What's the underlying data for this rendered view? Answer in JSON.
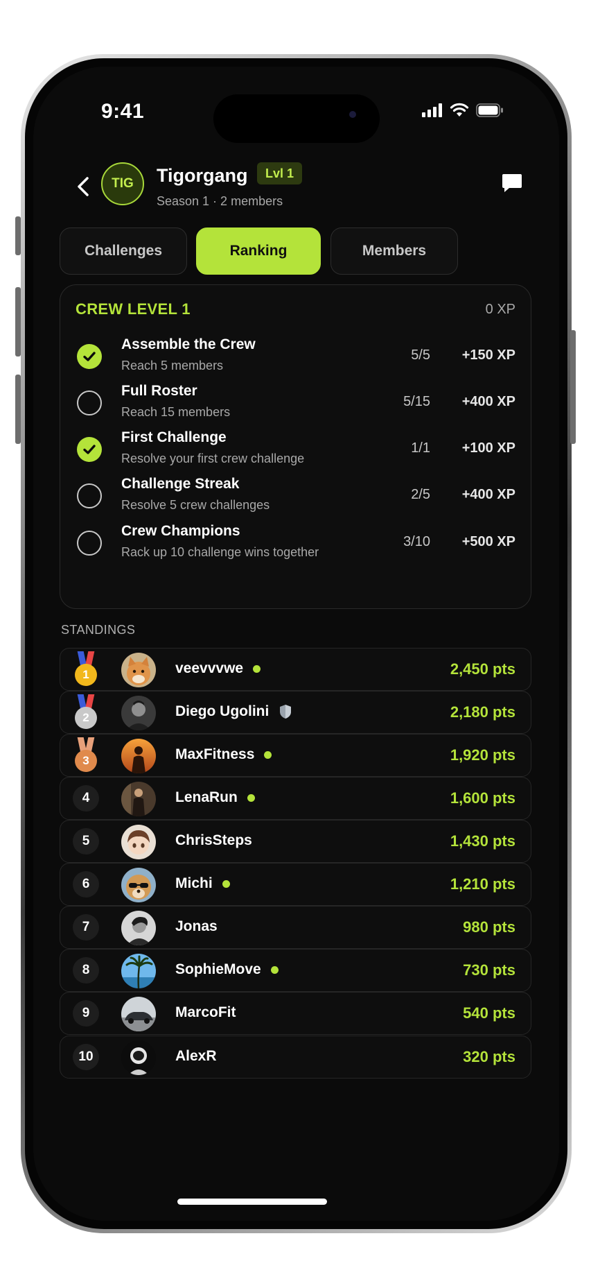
{
  "status_bar": {
    "time": "9:41"
  },
  "header": {
    "avatar_initials": "TIG",
    "crew_name": "Tigorgang",
    "level_badge": "Lvl 1",
    "subtitle": "Season 1 · 2 members"
  },
  "tabs": [
    {
      "label": "Challenges",
      "active": false
    },
    {
      "label": "Ranking",
      "active": true
    },
    {
      "label": "Members",
      "active": false
    }
  ],
  "crew_level": {
    "title": "CREW LEVEL 1",
    "xp": "0 XP",
    "goals": [
      {
        "title": "Assemble the Crew",
        "desc": "Reach 5 members",
        "progress": "5/5",
        "xp": "+150 XP",
        "done": true
      },
      {
        "title": "Full Roster",
        "desc": "Reach 15 members",
        "progress": "5/15",
        "xp": "+400 XP",
        "done": false
      },
      {
        "title": "First Challenge",
        "desc": "Resolve your first crew challenge",
        "progress": "1/1",
        "xp": "+100 XP",
        "done": true
      },
      {
        "title": "Challenge Streak",
        "desc": "Resolve 5 crew challenges",
        "progress": "2/5",
        "xp": "+400 XP",
        "done": false
      },
      {
        "title": "Crew Champions",
        "desc": "Rack up 10 challenge wins together",
        "progress": "3/10",
        "xp": "+500 XP",
        "done": false
      }
    ]
  },
  "standings": {
    "label": "STANDINGS",
    "rows": [
      {
        "rank": "1",
        "name": "veevvvwe",
        "points": "2,450 pts",
        "online": true,
        "medal": "gold",
        "avatar": "cat-avatar"
      },
      {
        "rank": "2",
        "name": "Diego Ugolini",
        "points": "2,180 pts",
        "online": false,
        "badge": "shield-icon",
        "medal": "silver",
        "avatar": "portrait-avatar"
      },
      {
        "rank": "3",
        "name": "MaxFitness",
        "points": "1,920 pts",
        "online": true,
        "medal": "bronze",
        "avatar": "sunset-silhouette-avatar"
      },
      {
        "rank": "4",
        "name": "LenaRun",
        "points": "1,600 pts",
        "online": true,
        "avatar": "figure-avatar"
      },
      {
        "rank": "5",
        "name": "ChrisSteps",
        "points": "1,430 pts",
        "online": false,
        "avatar": "anime-avatar"
      },
      {
        "rank": "6",
        "name": "Michi",
        "points": "1,210 pts",
        "online": true,
        "avatar": "dog-sunglasses-avatar"
      },
      {
        "rank": "7",
        "name": "Jonas",
        "points": "980 pts",
        "online": false,
        "avatar": "bw-portrait-avatar"
      },
      {
        "rank": "8",
        "name": "SophieMove",
        "points": "730 pts",
        "online": true,
        "avatar": "palm-tree-avatar"
      },
      {
        "rank": "9",
        "name": "MarcoFit",
        "points": "540 pts",
        "online": false,
        "avatar": "car-avatar"
      },
      {
        "rank": "10",
        "name": "AlexR",
        "points": "320 pts",
        "online": false,
        "avatar": "astronaut-avatar"
      }
    ]
  },
  "colors": {
    "accent": "#b4e33a",
    "background": "#0b0b0b",
    "gold": "#f2b81c",
    "silver": "#c9c9c9",
    "bronze": "#e08a4c"
  }
}
